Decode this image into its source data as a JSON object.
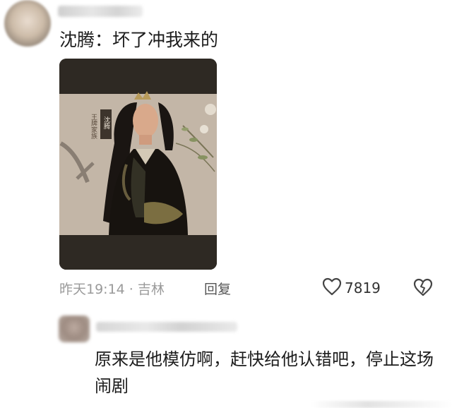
{
  "comment1": {
    "text": "沈腾：坏了冲我来的",
    "meta": "昨天19:14 · 吉林",
    "reply_label": "回复",
    "like_count": "7819",
    "photo": {
      "side_label": "王牌家族",
      "tag": "沈腾"
    }
  },
  "comment2": {
    "text": "原来是他模仿啊，赶快给他认错吧，停止这场闹剧"
  },
  "icons": {
    "like": "heart-icon",
    "dislike": "broken-heart-icon"
  }
}
